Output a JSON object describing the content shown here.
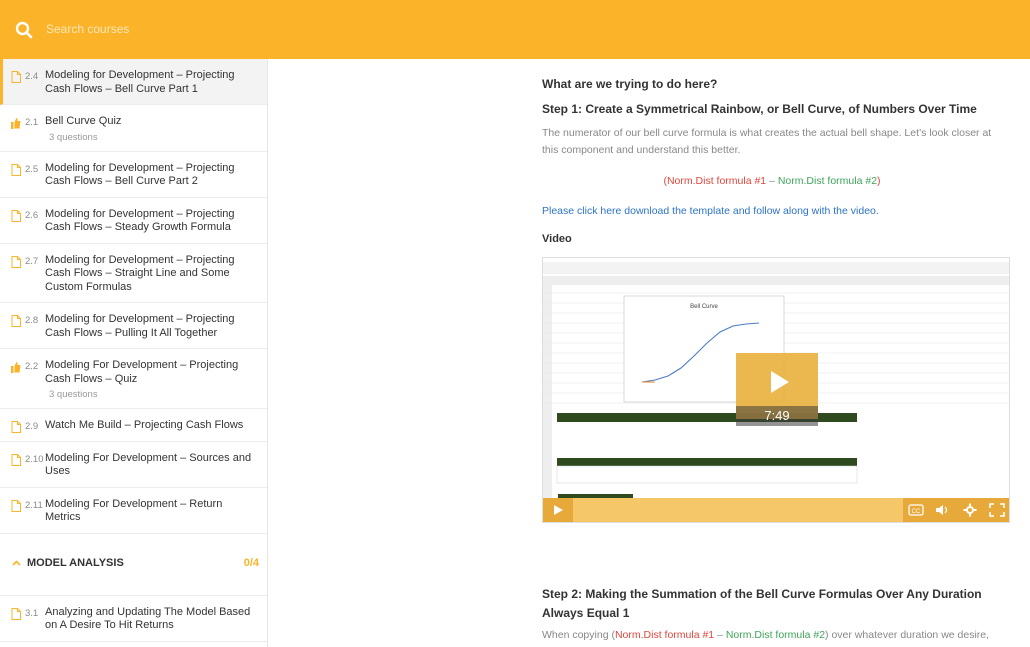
{
  "search": {
    "placeholder": "Search courses"
  },
  "sidebar": {
    "lessons": [
      {
        "num": "2.4",
        "title": "Modeling for Development – Projecting Cash Flows – Bell Curve Part 1",
        "type": "doc",
        "active": true
      },
      {
        "num": "2.1",
        "title": "Bell Curve Quiz",
        "sub": "3 questions",
        "type": "quiz"
      },
      {
        "num": "2.5",
        "title": "Modeling for Development – Projecting Cash Flows – Bell Curve Part 2",
        "type": "doc"
      },
      {
        "num": "2.6",
        "title": "Modeling for Development – Projecting Cash Flows – Steady Growth Formula",
        "type": "doc"
      },
      {
        "num": "2.7",
        "title": "Modeling for Development – Projecting Cash Flows – Straight Line and Some Custom Formulas",
        "type": "doc"
      },
      {
        "num": "2.8",
        "title": "Modeling for Development – Projecting Cash Flows – Pulling It All Together",
        "type": "doc"
      },
      {
        "num": "2.2",
        "title": "Modeling For Development – Projecting Cash Flows – Quiz",
        "sub": "3 questions",
        "type": "quiz"
      },
      {
        "num": "2.9",
        "title": "Watch Me Build – Projecting Cash Flows",
        "type": "doc"
      },
      {
        "num": "2.10",
        "title": "Modeling For Development – Sources and Uses",
        "type": "doc"
      },
      {
        "num": "2.11",
        "title": "Modeling For Development – Return Metrics",
        "type": "doc"
      }
    ],
    "section": {
      "label": "MODEL ANALYSIS",
      "count": "0/4"
    },
    "section_lessons": [
      {
        "num": "3.1",
        "title": "Analyzing and Updating The Model Based on A Desire To Hit Returns",
        "type": "doc"
      }
    ]
  },
  "main": {
    "question": "What are we trying to do here?",
    "step1_title": "Step 1: Create a Symmetrical Rainbow, or Bell Curve, of Numbers Over Time",
    "step1_text": "The numerator of our bell curve formula is what creates the actual bell shape. Let’s look closer at this component and understand this better.",
    "formula_open": "(",
    "formula_part1": "Norm.Dist formula #1",
    "formula_minus": " – ",
    "formula_part2": "Norm.Dist formula #2",
    "formula_close": ")",
    "download_link": "Please click here download the template and follow along with the video.",
    "video_label": "Video",
    "video_time": "7:49",
    "video_chart_title": "Bell Curve",
    "step2_title": "Step 2: Making the Summation of the Bell Curve Formulas Over Any Duration Always Equal 1",
    "step2_text_a": "When copying (",
    "step2_text_b": ") over whatever duration we desire,"
  },
  "colors": {
    "accent": "#fbb32a",
    "red": "#e0463b",
    "green": "#3fa35a",
    "link": "#2d73c7"
  }
}
